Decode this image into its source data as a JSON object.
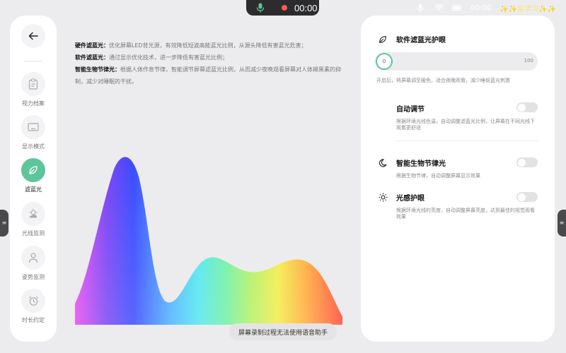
{
  "status_bar": {
    "record_time": "00:00",
    "clock": "00:00",
    "assistant_label": "✨✨爱学习✨✨"
  },
  "sidebar": {
    "items": [
      {
        "label": "视力档案",
        "icon": "clipboard-icon",
        "active": false
      },
      {
        "label": "显示模式",
        "icon": "display-icon",
        "active": false
      },
      {
        "label": "滤蓝光",
        "icon": "leaf-icon",
        "active": true
      },
      {
        "label": "光线监测",
        "icon": "sun-cloud-icon",
        "active": false
      },
      {
        "label": "姿势监测",
        "icon": "person-icon",
        "active": false
      },
      {
        "label": "时长约定",
        "icon": "alarm-clock-icon",
        "active": false
      }
    ]
  },
  "description": {
    "hardware_title": "硬件滤蓝光：",
    "hardware_text": "优化屏幕LED背光源，有效降低短波高能蓝光比例，从源头降低有害蓝光危害；",
    "software_title": "软件滤蓝光：",
    "software_text": "通过显示优化技术，进一步降低有害蓝光比例；",
    "circadian_title": "智能生物节律光：",
    "circadian_text": "根据人体作息节律，智能调节屏幕滤蓝光比例，从而减少夜晚观看屏幕对人体褪黑素的抑制，减少对睡眠的干扰。"
  },
  "toast": "屏幕录制过程无法使用语音助手",
  "panel": {
    "software_filter": {
      "title": "软件滤蓝光护眼",
      "slider_value": "0",
      "slider_max": "100",
      "note": "开启后，将屏幕调至暖色，适合夜晚观看，减少睡前蓝光刺激"
    },
    "auto_adjust": {
      "title": "自动调节",
      "enabled": false,
      "note": "根据环境光线色温，自动调整滤蓝光比例，让屏幕在不同光线下观看更舒适"
    },
    "circadian": {
      "title": "智能生物节律光",
      "enabled": false,
      "note": "根据生物节律，自动调整屏幕显示效果"
    },
    "light_sense": {
      "title": "光感护眼",
      "enabled": false,
      "note": "根据环境光线的亮度，自动调整屏幕亮度，达到最佳的视觉观看效果"
    }
  },
  "colors": {
    "accent": "#5ec59a",
    "panel_bg": "#ffffff",
    "page_bg": "#ececee",
    "record_dot": "#ff5a4e"
  }
}
